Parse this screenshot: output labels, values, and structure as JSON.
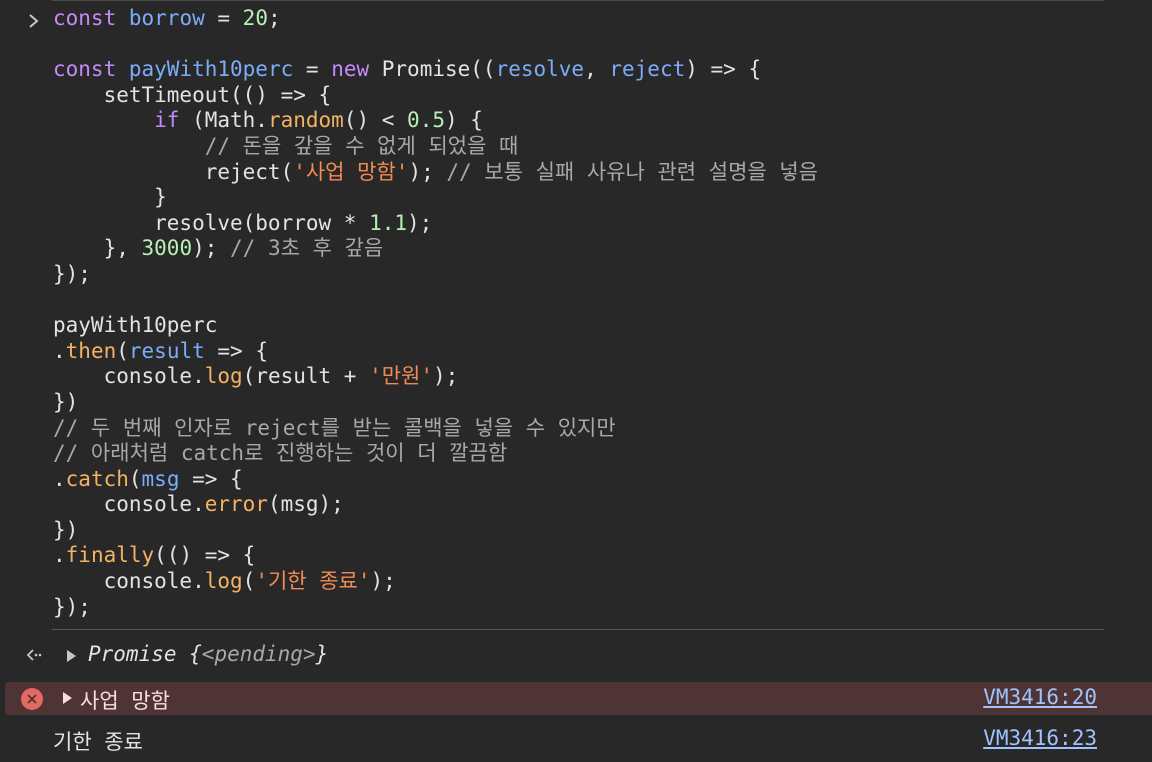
{
  "console": {
    "input": {
      "lines": [
        [
          [
            "kw",
            "const"
          ],
          [
            "",
            " "
          ],
          [
            "var",
            "borrow"
          ],
          [
            "",
            " = "
          ],
          [
            "num",
            "20"
          ],
          [
            "",
            ";"
          ]
        ],
        [],
        [
          [
            "kw",
            "const"
          ],
          [
            "",
            " "
          ],
          [
            "var",
            "payWith10perc"
          ],
          [
            "",
            " = "
          ],
          [
            "kw",
            "new"
          ],
          [
            "",
            " Promise(("
          ],
          [
            "var",
            "resolve"
          ],
          [
            "",
            ", "
          ],
          [
            "var",
            "reject"
          ],
          [
            "",
            ") => {"
          ]
        ],
        [
          [
            "",
            "    setTimeout(() => {"
          ]
        ],
        [
          [
            "",
            "        "
          ],
          [
            "kw",
            "if"
          ],
          [
            "",
            " (Math."
          ],
          [
            "fn",
            "random"
          ],
          [
            "",
            "() < "
          ],
          [
            "num",
            "0.5"
          ],
          [
            "",
            ") {"
          ]
        ],
        [
          [
            "",
            "            "
          ],
          [
            "cmt",
            "// 돈을 갚을 수 없게 되었을 때"
          ]
        ],
        [
          [
            "",
            "            reject("
          ],
          [
            "str",
            "'사업 망함'"
          ],
          [
            "",
            "); "
          ],
          [
            "cmt",
            "// 보통 실패 사유나 관련 설명을 넣음"
          ]
        ],
        [
          [
            "",
            "        }"
          ]
        ],
        [
          [
            "",
            "        resolve(borrow * "
          ],
          [
            "num",
            "1.1"
          ],
          [
            "",
            ");"
          ]
        ],
        [
          [
            "",
            "    }, "
          ],
          [
            "num",
            "3000"
          ],
          [
            "",
            "); "
          ],
          [
            "cmt",
            "// 3초 후 갚음"
          ]
        ],
        [
          [
            "",
            "});"
          ]
        ],
        [],
        [
          [
            "",
            "payWith10perc"
          ]
        ],
        [
          [
            "",
            "."
          ],
          [
            "fn",
            "then"
          ],
          [
            "",
            "("
          ],
          [
            "var",
            "result"
          ],
          [
            "",
            " => {"
          ]
        ],
        [
          [
            "",
            "    console."
          ],
          [
            "fn",
            "log"
          ],
          [
            "",
            "(result + "
          ],
          [
            "str",
            "'만원'"
          ],
          [
            "",
            ");"
          ]
        ],
        [
          [
            "",
            "})"
          ]
        ],
        [
          [
            "cmt",
            "// 두 번째 인자로 reject를 받는 콜백을 넣을 수 있지만"
          ]
        ],
        [
          [
            "cmt",
            "// 아래처럼 catch로 진행하는 것이 더 깔끔함"
          ]
        ],
        [
          [
            "",
            "."
          ],
          [
            "fn",
            "catch"
          ],
          [
            "",
            "("
          ],
          [
            "var",
            "msg"
          ],
          [
            "",
            " => {"
          ]
        ],
        [
          [
            "",
            "    console."
          ],
          [
            "fn",
            "error"
          ],
          [
            "",
            "(msg);"
          ]
        ],
        [
          [
            "",
            "})"
          ]
        ],
        [
          [
            "",
            "."
          ],
          [
            "fn",
            "finally"
          ],
          [
            "",
            "(() => {"
          ]
        ],
        [
          [
            "",
            "    console."
          ],
          [
            "fn",
            "log"
          ],
          [
            "",
            "("
          ],
          [
            "str",
            "'기한 종료'"
          ],
          [
            "",
            ");"
          ]
        ],
        [
          [
            "",
            "});"
          ]
        ]
      ]
    },
    "result": {
      "prefix": "Promise {",
      "state": "<pending>",
      "suffix": "}"
    },
    "error_entry": {
      "message": "사업 망함",
      "source": "VM3416:20"
    },
    "log_entry": {
      "message": "기한 종료",
      "source": "VM3416:23"
    },
    "icons": {
      "prompt": "chevron-right-icon",
      "return": "return-arrow-icon",
      "error": "error-circle-icon",
      "expand": "triangle-right-icon"
    },
    "colors": {
      "background": "#282828",
      "keyword": "#c58af9",
      "variable": "#7cacf8",
      "number": "#b6f0b6",
      "string": "#f28b54",
      "function": "#f4b264",
      "comment": "#a8a8a8",
      "error_bg": "#4e3434",
      "error_icon": "#e46962",
      "link": "#9fc3ff"
    }
  }
}
